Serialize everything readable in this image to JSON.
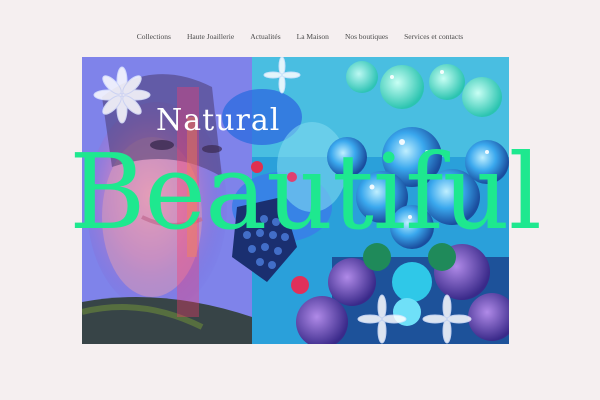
{
  "nav": {
    "items": [
      {
        "label": "Collections"
      },
      {
        "label": "Haute Joaillerie"
      },
      {
        "label": "Actualités"
      },
      {
        "label": "La Maison"
      },
      {
        "label": "Nos boutiques"
      },
      {
        "label": "Services et contacts"
      }
    ]
  },
  "hero": {
    "line1": "Natural",
    "line2": "Beautiful"
  },
  "colors": {
    "background": "#f5eff0",
    "accent_green": "#1ee88f",
    "nav_text": "#4a4a4a"
  }
}
